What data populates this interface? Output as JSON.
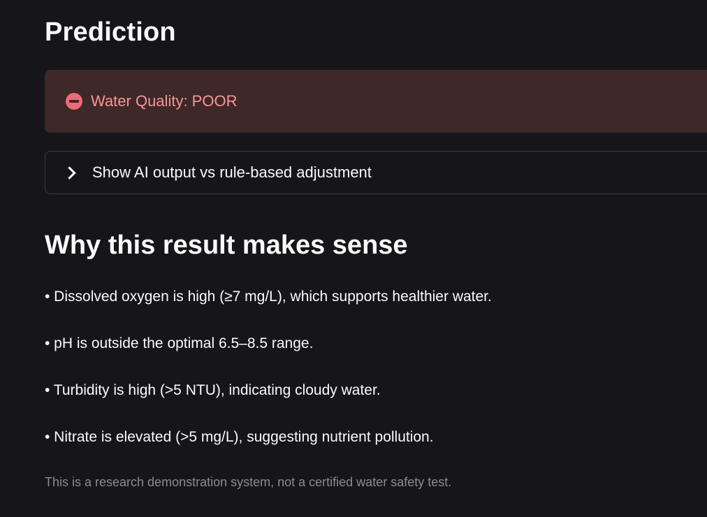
{
  "prediction": {
    "title": "Prediction",
    "alert": {
      "icon": "no-entry-icon",
      "text": "Water Quality: POOR",
      "color": "#f6969a",
      "background": "#3e2828"
    },
    "expander": {
      "label": "Show AI output vs rule-based adjustment",
      "icon": "chevron-right-icon"
    }
  },
  "explanation": {
    "title": "Why this result makes sense",
    "reasons": [
      "• Dissolved oxygen is high (≥7 mg/L), which supports healthier water.",
      "• pH is outside the optimal 6.5–8.5 range.",
      "• Turbidity is high (>5 NTU), indicating cloudy water.",
      "• Nitrate is elevated (>5 mg/L), suggesting nutrient pollution."
    ],
    "disclaimer": "This is a research demonstration system, not a certified water safety test."
  }
}
